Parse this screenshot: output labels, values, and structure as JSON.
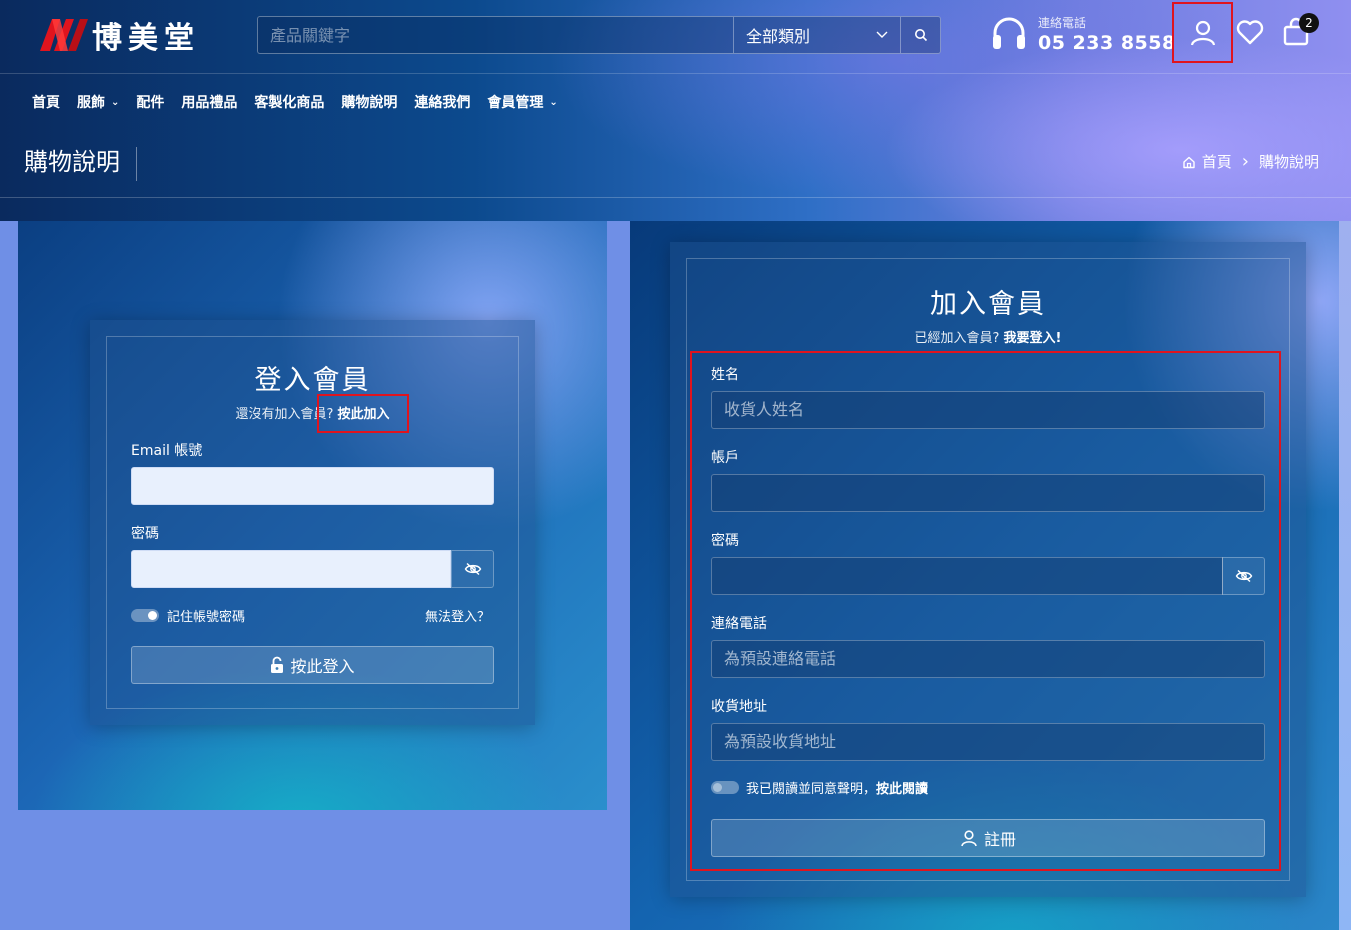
{
  "brand": {
    "name": "博美堂",
    "accent": "#e0141e"
  },
  "search": {
    "placeholder": "產品關鍵字",
    "category": "全部類別",
    "button_icon": "search-icon"
  },
  "contact": {
    "label": "連絡電話",
    "phone": "05 233 8558"
  },
  "header_icons": {
    "account": "user-icon",
    "wishlist": "heart-icon",
    "cart": "shopping-bag-icon",
    "cart_count": "2"
  },
  "nav": {
    "items": [
      {
        "label": "首頁"
      },
      {
        "label": "服飾",
        "chevron": "⌄"
      },
      {
        "label": "配件"
      },
      {
        "label": "用品禮品"
      },
      {
        "label": "客製化商品"
      },
      {
        "label": "購物說明"
      },
      {
        "label": "連絡我們"
      },
      {
        "label": "會員管理",
        "chevron": "⌄"
      }
    ]
  },
  "page": {
    "title": "購物說明"
  },
  "breadcrumb": {
    "home": "首頁",
    "separator": "›",
    "current": "購物說明"
  },
  "login": {
    "title": "登入會員",
    "sub_text": "還沒有加入會員?",
    "sub_link": "按此加入",
    "email_label": "Email 帳號",
    "password_label": "密碼",
    "remember_label": "記住帳號密碼",
    "remember_on": true,
    "forgot_link": "無法登入？",
    "submit_label": "按此登入"
  },
  "register": {
    "title": "加入會員",
    "sub_text": "已經加入會員?",
    "sub_link": "我要登入!",
    "name_label": "姓名",
    "name_placeholder": "收貨人姓名",
    "account_label": "帳戶",
    "password_label": "密碼",
    "phone_label": "連絡電話",
    "phone_placeholder": "為預設連絡電話",
    "address_label": "收貨地址",
    "address_placeholder": "為預設收貨地址",
    "agree_text": "我已閱讀並同意聲明，",
    "agree_link": "按此閱讀",
    "agree_on": false,
    "submit_label": "註冊"
  }
}
